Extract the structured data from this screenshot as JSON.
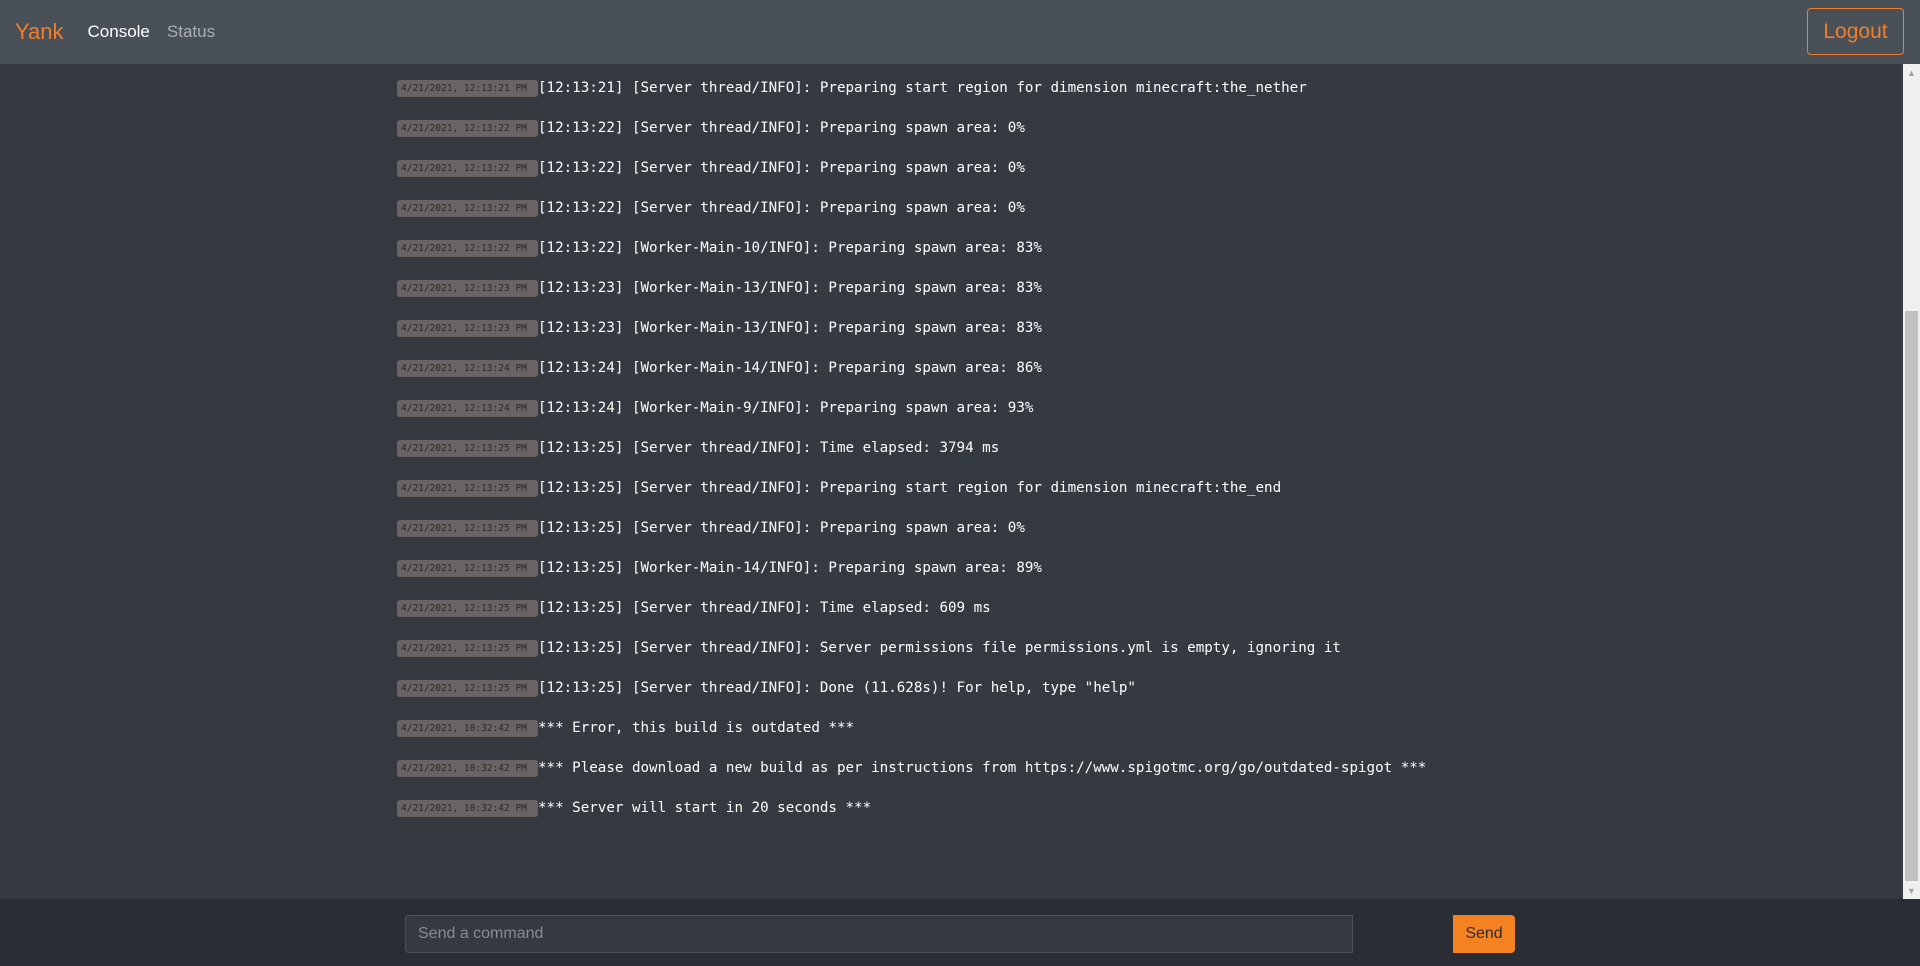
{
  "nav": {
    "brand": "Yank",
    "links": [
      {
        "label": "Console"
      },
      {
        "label": "Status"
      }
    ],
    "logout_label": "Logout"
  },
  "colors": {
    "accent": "#f07e2a",
    "navbar": "#4a5058",
    "background": "#353a41",
    "footer": "#2a2d33",
    "timestamp_badge": "#6a6363"
  },
  "logs": [
    {
      "ts": "4/21/2021, 12:13:21 PM",
      "msg": "[12:13:21] [Server thread/INFO]: Preparing start region for dimension minecraft:the_nether"
    },
    {
      "ts": "4/21/2021, 12:13:22 PM",
      "msg": "[12:13:22] [Server thread/INFO]: Preparing spawn area: 0%"
    },
    {
      "ts": "4/21/2021, 12:13:22 PM",
      "msg": "[12:13:22] [Server thread/INFO]: Preparing spawn area: 0%"
    },
    {
      "ts": "4/21/2021, 12:13:22 PM",
      "msg": "[12:13:22] [Server thread/INFO]: Preparing spawn area: 0%"
    },
    {
      "ts": "4/21/2021, 12:13:22 PM",
      "msg": "[12:13:22] [Worker-Main-10/INFO]: Preparing spawn area: 83%"
    },
    {
      "ts": "4/21/2021, 12:13:23 PM",
      "msg": "[12:13:23] [Worker-Main-13/INFO]: Preparing spawn area: 83%"
    },
    {
      "ts": "4/21/2021, 12:13:23 PM",
      "msg": "[12:13:23] [Worker-Main-13/INFO]: Preparing spawn area: 83%"
    },
    {
      "ts": "4/21/2021, 12:13:24 PM",
      "msg": "[12:13:24] [Worker-Main-14/INFO]: Preparing spawn area: 86%"
    },
    {
      "ts": "4/21/2021, 12:13:24 PM",
      "msg": "[12:13:24] [Worker-Main-9/INFO]: Preparing spawn area: 93%"
    },
    {
      "ts": "4/21/2021, 12:13:25 PM",
      "msg": "[12:13:25] [Server thread/INFO]: Time elapsed: 3794 ms"
    },
    {
      "ts": "4/21/2021, 12:13:25 PM",
      "msg": "[12:13:25] [Server thread/INFO]: Preparing start region for dimension minecraft:the_end"
    },
    {
      "ts": "4/21/2021, 12:13:25 PM",
      "msg": "[12:13:25] [Server thread/INFO]: Preparing spawn area: 0%"
    },
    {
      "ts": "4/21/2021, 12:13:25 PM",
      "msg": "[12:13:25] [Worker-Main-14/INFO]: Preparing spawn area: 89%"
    },
    {
      "ts": "4/21/2021, 12:13:25 PM",
      "msg": "[12:13:25] [Server thread/INFO]: Time elapsed: 609 ms"
    },
    {
      "ts": "4/21/2021, 12:13:25 PM",
      "msg": "[12:13:25] [Server thread/INFO]: Server permissions file permissions.yml is empty, ignoring it"
    },
    {
      "ts": "4/21/2021, 12:13:25 PM",
      "msg": "[12:13:25] [Server thread/INFO]: Done (11.628s)! For help, type \"help\""
    },
    {
      "ts": "4/21/2021, 10:32:42 PM",
      "msg": "*** Error, this build is outdated ***"
    },
    {
      "ts": "4/21/2021, 10:32:42 PM",
      "msg": "*** Please download a new build as per instructions from https://www.spigotmc.org/go/outdated-spigot ***"
    },
    {
      "ts": "4/21/2021, 10:32:42 PM",
      "msg": "*** Server will start in 20 seconds ***"
    }
  ],
  "command": {
    "placeholder": "Send a command",
    "value": "",
    "send_label": "Send"
  }
}
